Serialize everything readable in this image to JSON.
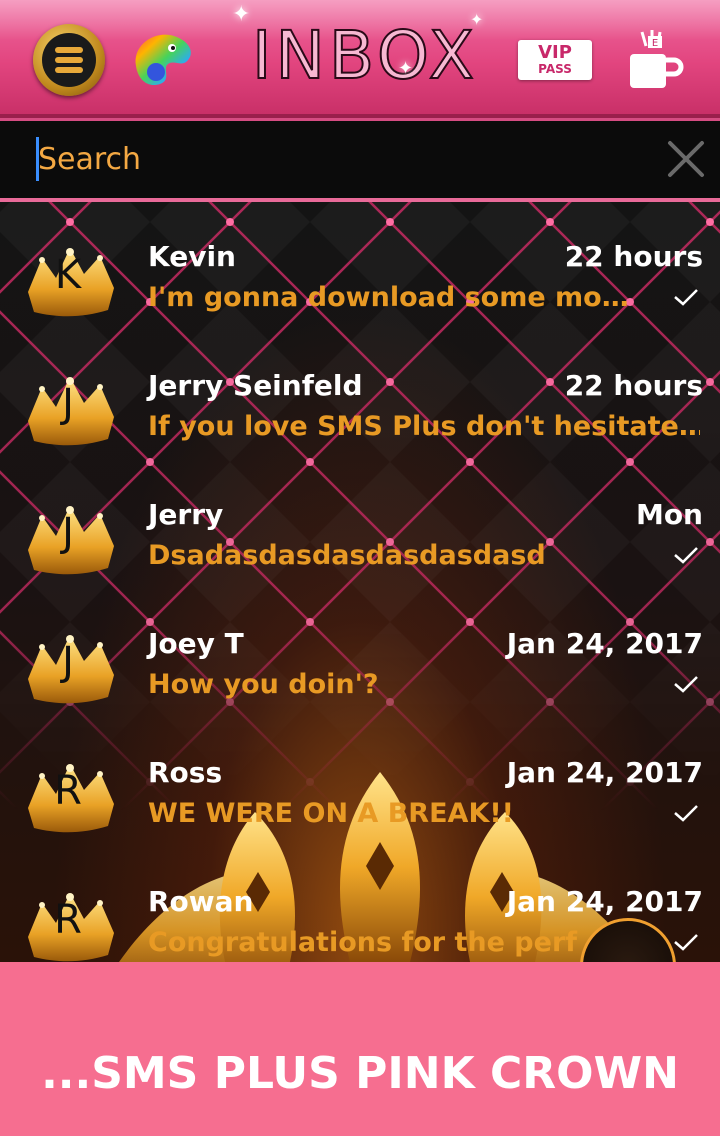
{
  "header": {
    "title": "INBOX",
    "vip_line1": "VIP",
    "vip_line2": "PASS",
    "icons": [
      "menu-icon",
      "theme-palette-icon",
      "vip-pass-icon",
      "coffee-mug-icon"
    ]
  },
  "search": {
    "placeholder": "Search",
    "value": ""
  },
  "conversations": [
    {
      "initial": "K",
      "name": "Kevin",
      "time": "22 hours",
      "preview": "I'm gonna download some mo…",
      "delivered": true
    },
    {
      "initial": "J",
      "name": "Jerry Seinfeld",
      "time": "22 hours",
      "preview": "If you love SMS Plus don't hesitate…",
      "delivered": false
    },
    {
      "initial": "J",
      "name": "Jerry",
      "time": "Mon",
      "preview": "Dsadasdasdasdasdasdasd",
      "delivered": true
    },
    {
      "initial": "J",
      "name": "Joey T",
      "time": "Jan 24, 2017",
      "preview": "How you doin'?",
      "delivered": true
    },
    {
      "initial": "R",
      "name": "Ross",
      "time": "Jan 24, 2017",
      "preview": "WE WERE ON A BREAK!!",
      "delivered": true
    },
    {
      "initial": "R",
      "name": "Rowan",
      "time": "Jan 24, 2017",
      "preview": "Congratulations for the perfe",
      "delivered": true
    }
  ],
  "banner": {
    "text": "...SMS PLUS PINK CROWN"
  },
  "colors": {
    "header_pink": "#e2457f",
    "preview_orange": "#e89a24",
    "banner_pink": "#f66e90",
    "quilt_line": "#d8336e"
  }
}
